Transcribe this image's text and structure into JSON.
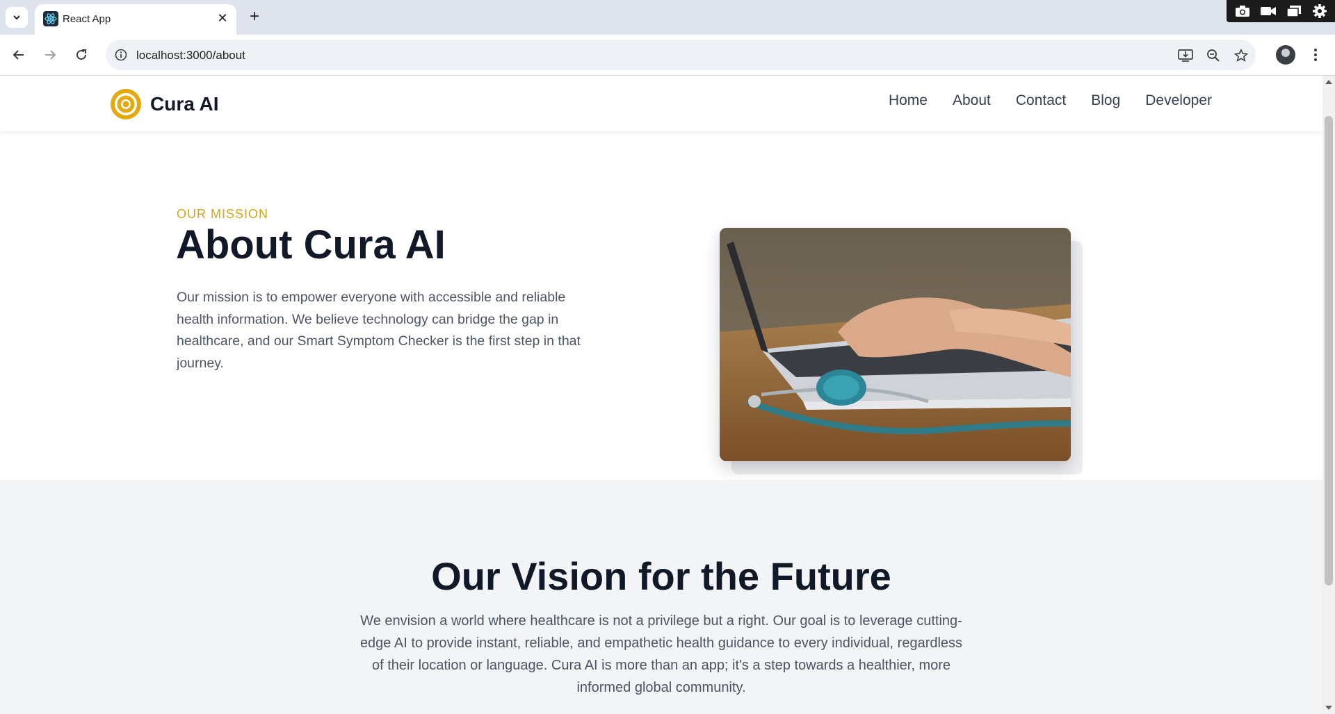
{
  "browser": {
    "tab_title": "React App",
    "url": "localhost:3000/about"
  },
  "site": {
    "brand": "Cura AI",
    "brand_color": "#e2aa0e",
    "nav": [
      {
        "label": "Home"
      },
      {
        "label": "About"
      },
      {
        "label": "Contact"
      },
      {
        "label": "Blog"
      },
      {
        "label": "Developer"
      }
    ]
  },
  "mission": {
    "eyebrow": "OUR MISSION",
    "title": "About Cura AI",
    "text": "Our mission is to empower everyone with accessible and reliable health information. We believe technology can bridge the gap in healthcare, and our Smart Symptom Checker is the first step in that journey.",
    "image_icon": "laptop-stethoscope-photo"
  },
  "vision": {
    "title": "Our Vision for the Future",
    "text": "We envision a world where healthcare is not a privilege but a right. Our goal is to leverage cutting-edge AI to provide instant, reliable, and empathetic health guidance to every individual, regardless of their location or language. Cura AI is more than an app; it's a step towards a healthier, more informed global community."
  }
}
